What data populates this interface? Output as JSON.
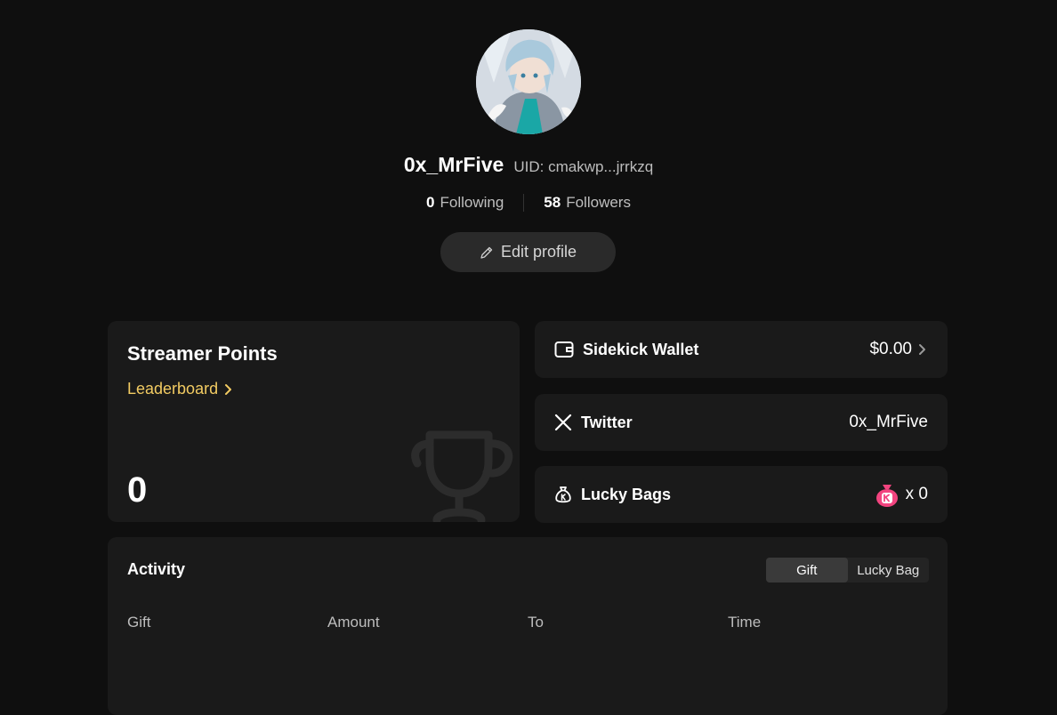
{
  "profile": {
    "username": "0x_MrFive",
    "uid": "UID: cmakwp...jrrkzq",
    "following_count": "0",
    "following_label": "Following",
    "followers_count": "58",
    "followers_label": "Followers",
    "edit_label": "Edit profile"
  },
  "points": {
    "title": "Streamer Points",
    "leaderboard_label": "Leaderboard",
    "value": "0"
  },
  "wallet": {
    "label": "Sidekick Wallet",
    "value": "$0.00"
  },
  "twitter": {
    "label": "Twitter",
    "value": "0x_MrFive"
  },
  "lucky_bags": {
    "label": "Lucky Bags",
    "count": "x 0"
  },
  "activity": {
    "title": "Activity",
    "tabs": [
      {
        "label": "Gift",
        "active": true
      },
      {
        "label": "Lucky Bag",
        "active": false
      }
    ],
    "columns": [
      "Gift",
      "Amount",
      "To",
      "Time"
    ]
  },
  "colors": {
    "background": "#0f0f0f",
    "card": "#1a1a1a",
    "accent_gold": "#f2cb62",
    "lucky_bag_pink": "#f2447f"
  },
  "icons": [
    "pencil-icon",
    "chevron-right-icon",
    "trophy-icon",
    "wallet-icon",
    "x-logo-icon",
    "money-bag-icon",
    "lucky-bag-icon"
  ]
}
